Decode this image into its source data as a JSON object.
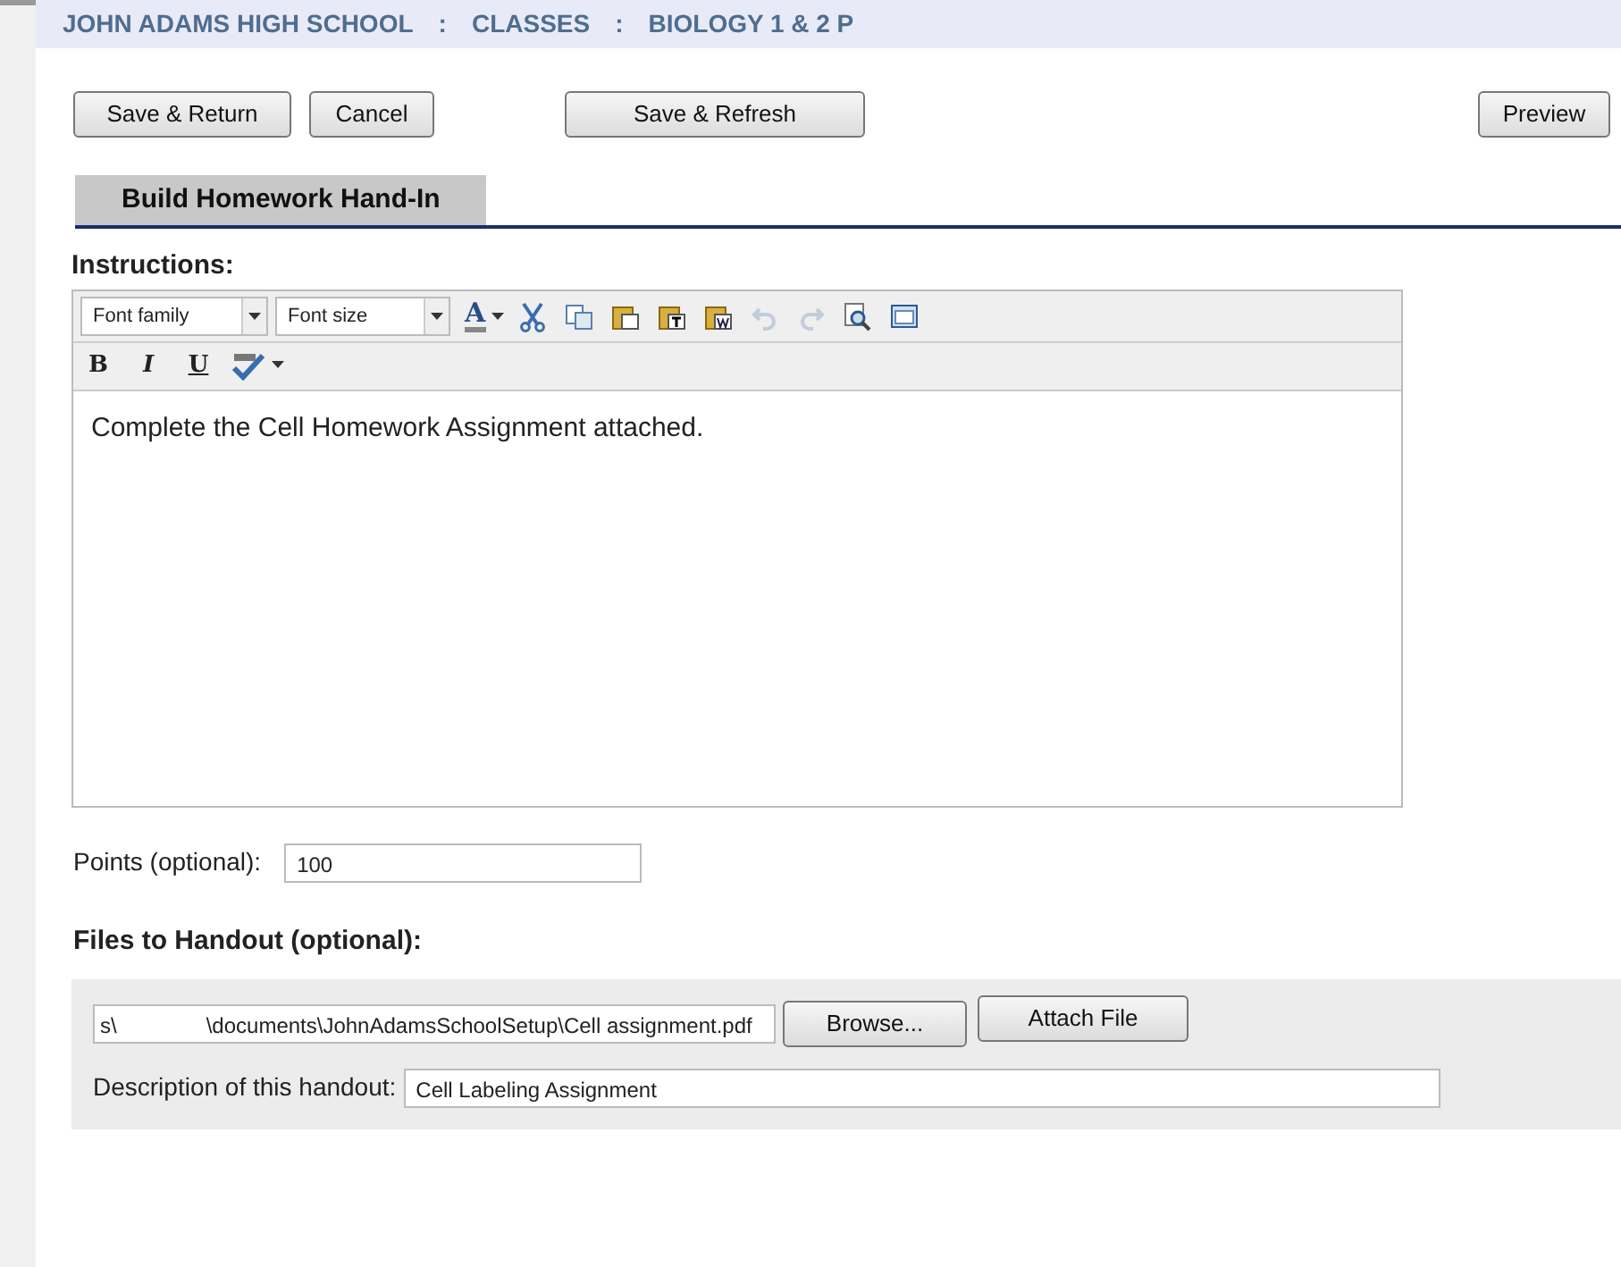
{
  "breadcrumb": [
    "JOHN ADAMS HIGH SCHOOL",
    ":",
    "CLASSES",
    ":",
    "BIOLOGY 1 & 2 P"
  ],
  "buttons": [
    {
      "label": "Save & Return",
      "kind": "left"
    },
    {
      "label": "Cancel",
      "kind": "left"
    },
    {
      "label": "Save & Refresh",
      "kind": "middle"
    },
    {
      "label": "Preview",
      "kind": "right"
    }
  ],
  "section_tab": "Build Homework Hand-In",
  "instructions": {
    "label": "Instructions:",
    "font_family": "Font family",
    "font_size": "Font size",
    "text_color_glyph": "A",
    "tools": [
      {
        "kind": "cut",
        "disabled": false
      },
      {
        "kind": "copy",
        "disabled": false
      },
      {
        "kind": "paste",
        "disabled": false
      },
      {
        "kind": "paste-text",
        "disabled": false
      },
      {
        "kind": "paste-word",
        "disabled": false
      },
      {
        "kind": "undo",
        "disabled": true
      },
      {
        "kind": "redo",
        "disabled": true
      },
      {
        "kind": "find",
        "disabled": false
      },
      {
        "kind": "fullscreen",
        "disabled": false
      }
    ],
    "format_buttons": [
      {
        "label": "B",
        "kind": "bold"
      },
      {
        "label": "I",
        "kind": "italic"
      },
      {
        "label": "U",
        "kind": "underline"
      }
    ],
    "content": "Complete the Cell Homework Assignment attached."
  },
  "points": {
    "label": "Points (optional):",
    "value": "100"
  },
  "files": {
    "heading": "Files to Handout (optional):",
    "path_start": "s\\",
    "path_rest": "\\documents\\JohnAdamsSchoolSetup\\Cell assignment.pdf",
    "browse": "Browse...",
    "attach": "Attach File",
    "description_label": "Description of this handout:",
    "description_value": "Cell Labeling Assignment"
  }
}
